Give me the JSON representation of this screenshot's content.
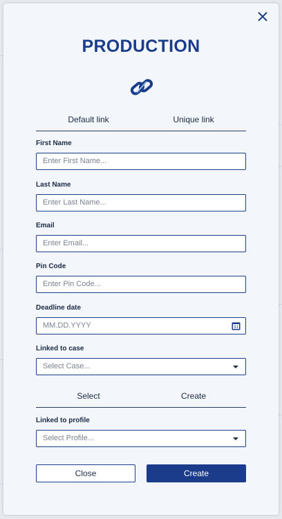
{
  "modal": {
    "title": "PRODUCTION",
    "link_tabs": [
      "Default link",
      "Unique link"
    ],
    "fields": {
      "first_name": {
        "label": "First Name",
        "placeholder": "Enter First Name..."
      },
      "last_name": {
        "label": "Last Name",
        "placeholder": "Enter Last Name..."
      },
      "email": {
        "label": "Email",
        "placeholder": "Enter Email..."
      },
      "pin_code": {
        "label": "Pin Code",
        "placeholder": "Enter Pin Code..."
      },
      "deadline": {
        "label": "Deadline date",
        "placeholder": "MM.DD.YYYY",
        "icon_text": "31"
      },
      "linked_case": {
        "label": "Linked to case",
        "placeholder": "Select Case..."
      },
      "linked_profile": {
        "label": "Linked to profile",
        "placeholder": "Select Profile..."
      }
    },
    "profile_tabs": [
      "Select",
      "Create"
    ],
    "buttons": {
      "close": "Close",
      "create": "Create"
    }
  },
  "colors": {
    "primary": "#1a3c8a",
    "panel": "#f3f6fb",
    "text": "#1c2a44",
    "placeholder": "#7b8290"
  },
  "icons": {
    "close": "close-icon",
    "link": "link-icon",
    "calendar": "calendar-icon",
    "dropdown": "chevron-down-icon"
  }
}
